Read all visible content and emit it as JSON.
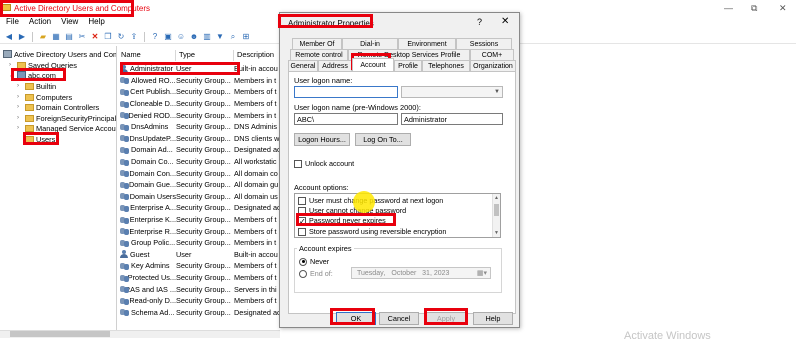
{
  "window": {
    "title": "Active Directory Users and Computers",
    "minimize": "—",
    "restore": "⧉",
    "close": "✕"
  },
  "menu": [
    "File",
    "Action",
    "View",
    "Help"
  ],
  "tree": {
    "root": "Active Directory Users and Com",
    "items": [
      {
        "label": "Saved Queries",
        "level": 1
      },
      {
        "label": "abc.com",
        "level": 1
      },
      {
        "label": "Builtin",
        "level": 2
      },
      {
        "label": "Computers",
        "level": 2
      },
      {
        "label": "Domain Controllers",
        "level": 2
      },
      {
        "label": "ForeignSecurityPrincipal",
        "level": 2
      },
      {
        "label": "Managed Service Accour",
        "level": 2
      },
      {
        "label": "Users",
        "level": 2
      }
    ]
  },
  "list": {
    "headers": [
      "Name",
      "Type",
      "Description"
    ],
    "rows": [
      {
        "name": "Administrator",
        "type": "User",
        "desc": "Built-in accou",
        "icon": "user"
      },
      {
        "name": "Allowed RO...",
        "type": "Security Group...",
        "desc": "Members in t",
        "icon": "group"
      },
      {
        "name": "Cert Publish...",
        "type": "Security Group...",
        "desc": "Members of t",
        "icon": "group"
      },
      {
        "name": "Cloneable D...",
        "type": "Security Group...",
        "desc": "Members of t",
        "icon": "group"
      },
      {
        "name": "Denied ROD...",
        "type": "Security Group...",
        "desc": "Members in t",
        "icon": "group"
      },
      {
        "name": "DnsAdmins",
        "type": "Security Group...",
        "desc": "DNS Adminis",
        "icon": "group"
      },
      {
        "name": "DnsUpdateP...",
        "type": "Security Group...",
        "desc": "DNS clients w",
        "icon": "group"
      },
      {
        "name": "Domain Ad...",
        "type": "Security Group...",
        "desc": "Designated ac",
        "icon": "group"
      },
      {
        "name": "Domain Co...",
        "type": "Security Group...",
        "desc": "All workstatic",
        "icon": "group"
      },
      {
        "name": "Domain Con...",
        "type": "Security Group...",
        "desc": "All domain co",
        "icon": "group"
      },
      {
        "name": "Domain Gue...",
        "type": "Security Group...",
        "desc": "All domain gu",
        "icon": "group"
      },
      {
        "name": "Domain Users",
        "type": "Security Group...",
        "desc": "All domain us",
        "icon": "group"
      },
      {
        "name": "Enterprise A...",
        "type": "Security Group...",
        "desc": "Designated ac",
        "icon": "group"
      },
      {
        "name": "Enterprise K...",
        "type": "Security Group...",
        "desc": "Members of t",
        "icon": "group"
      },
      {
        "name": "Enterprise R...",
        "type": "Security Group...",
        "desc": "Members of t",
        "icon": "group"
      },
      {
        "name": "Group Polic...",
        "type": "Security Group...",
        "desc": "Members in t",
        "icon": "group"
      },
      {
        "name": "Guest",
        "type": "User",
        "desc": "Built-in accou",
        "icon": "user"
      },
      {
        "name": "Key Admins",
        "type": "Security Group...",
        "desc": "Members of t",
        "icon": "group"
      },
      {
        "name": "Protected Us...",
        "type": "Security Group...",
        "desc": "Members of t",
        "icon": "group"
      },
      {
        "name": "RAS and IAS ...",
        "type": "Security Group...",
        "desc": "Servers in thi",
        "icon": "group"
      },
      {
        "name": "Read-only D...",
        "type": "Security Group...",
        "desc": "Members of t",
        "icon": "group"
      },
      {
        "name": "Schema Ad...",
        "type": "Security Group...",
        "desc": "Designated ac",
        "icon": "group"
      }
    ]
  },
  "dialog": {
    "title": "Administrator Properties",
    "help": "?",
    "close": "✕",
    "tabs_row1": [
      "Member Of",
      "Dial-in",
      "Environment",
      "Sessions"
    ],
    "tabs_row2": [
      "Remote control",
      "Remote Desktop Services Profile",
      "COM+"
    ],
    "tabs_row3": [
      "General",
      "Address",
      "Account",
      "Profile",
      "Telephones",
      "Organization"
    ],
    "logon_name_label": "User logon name:",
    "logon_name_value": "",
    "upn_suffix": "",
    "pre2000_label": "User logon name (pre-Windows 2000):",
    "pre2000_domain": "ABC\\",
    "pre2000_user": "Administrator",
    "logon_hours_btn": "Logon Hours...",
    "logon_to_btn": "Log On To...",
    "unlock_label": "Unlock account",
    "options_label": "Account options:",
    "options": [
      {
        "label": "User must change password at next logon",
        "checked": false
      },
      {
        "label": "User cannot change password",
        "checked": false
      },
      {
        "label": "Password never expires",
        "checked": true
      },
      {
        "label": "Store password using reversible encryption",
        "checked": false
      }
    ],
    "expires_label": "Account expires",
    "never_label": "Never",
    "endof_label": "End of:",
    "date": {
      "weekday": "Tuesday",
      "sep": ",",
      "month": "October",
      "day": "31",
      "year": "2023"
    },
    "buttons": {
      "ok": "OK",
      "cancel": "Cancel",
      "apply": "Apply",
      "help": "Help"
    }
  },
  "watermark": "Activate Windows",
  "colors": {
    "highlight": "#e8000d",
    "focus": "#3a78c9",
    "cursor": "#ffe800"
  }
}
